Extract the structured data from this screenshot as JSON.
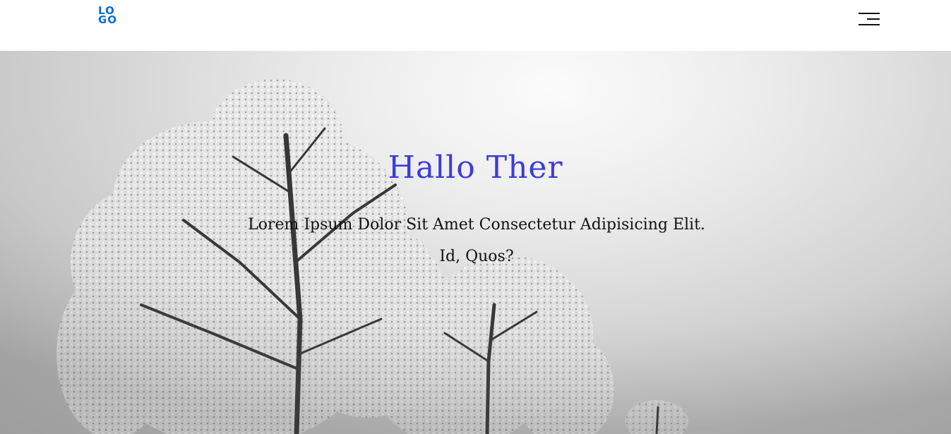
{
  "header": {
    "logo": {
      "line1": "LO",
      "line2": "GO",
      "color": "#0a6bd6"
    },
    "menu_icon": "hamburger-menu-icon"
  },
  "hero": {
    "title": "Hallo Ther",
    "subtitle": "Lorem Ipsum Dolor Sit Amet Consectetur Adipisicing Elit. Id, Quos?",
    "title_color": "#3b3bdc",
    "subtitle_color": "#111111",
    "background": "grayscale photo of snow-covered trees"
  }
}
